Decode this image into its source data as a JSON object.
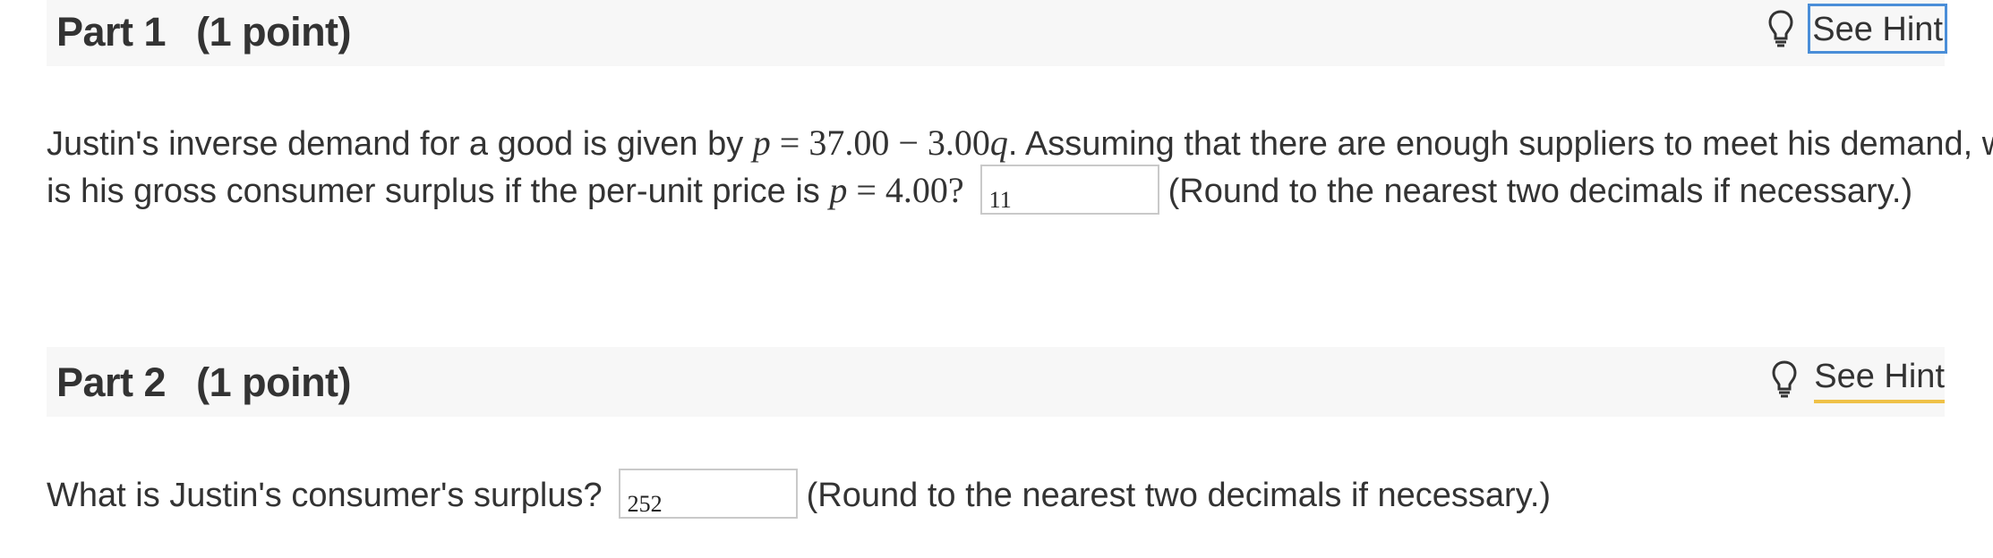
{
  "parts": [
    {
      "title": "Part 1",
      "points": "(1 point)",
      "hint_label": "See Hint",
      "question_line1_before_math": "Justin's inverse demand for a good is given by ",
      "math_demand": {
        "var_p": "p",
        "eq": " = 37.00 − 3.00",
        "var_q": "q",
        "dot": "."
      },
      "question_line1_after_math": " Assuming that there are enough suppliers to meet his demand, what",
      "question_line2_before_math": "is his gross consumer surplus if the per-unit price is ",
      "math_price": {
        "var_p": "p",
        "eq": " = 4.00?"
      },
      "answer_value": "11",
      "rounding_note": "(Round to the nearest two decimals if necessary.)"
    },
    {
      "title": "Part 2",
      "points": "(1 point)",
      "hint_label": "See Hint",
      "question": "What is Justin's consumer's surplus?",
      "answer_value": "252",
      "rounding_note": "(Round to the nearest two decimals if necessary.)"
    }
  ],
  "colors": {
    "header_bg": "#f7f7f7",
    "text": "#333333",
    "focus_outline": "#4a8ed8",
    "hint_underline": "#efc148",
    "input_border": "#c9c9c9"
  },
  "icons": {
    "hint": "lightbulb-icon"
  }
}
